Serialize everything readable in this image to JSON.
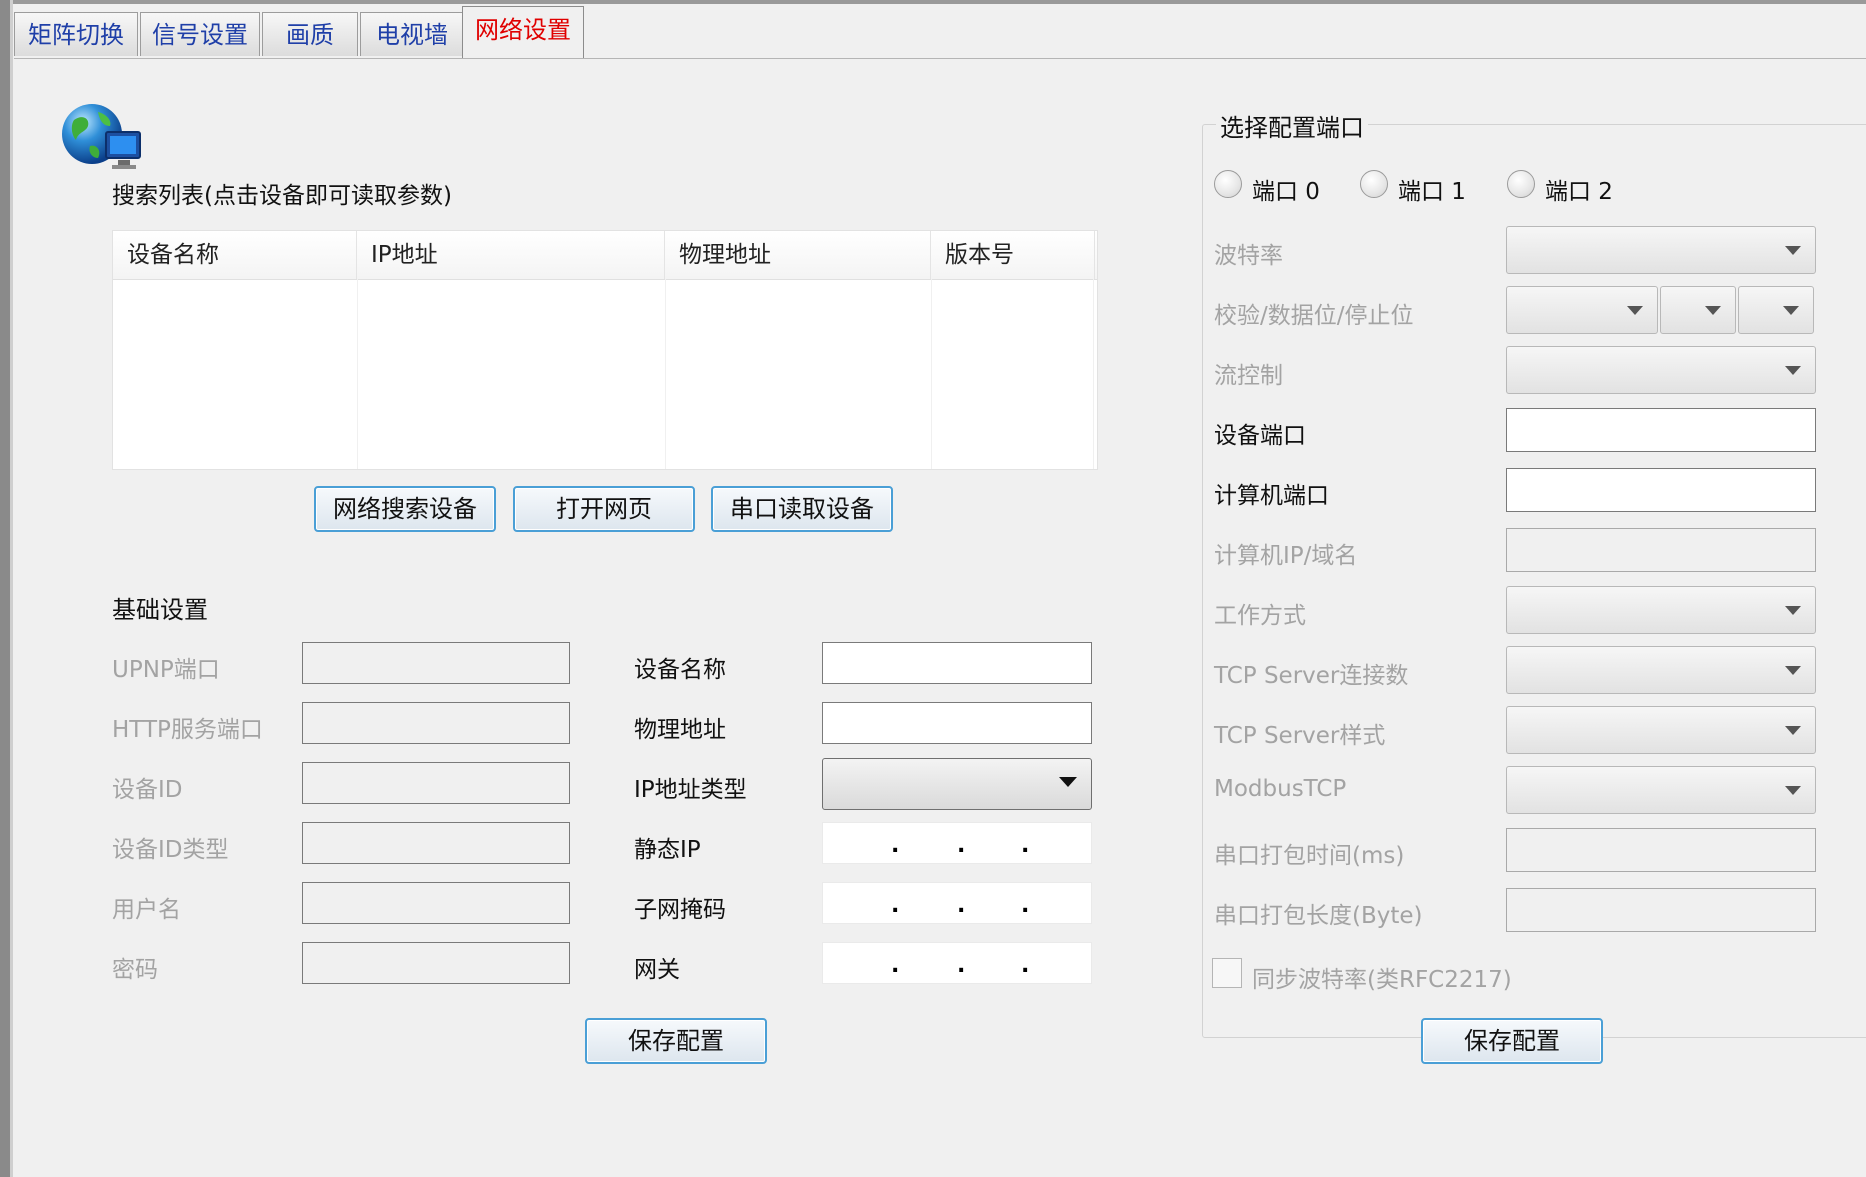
{
  "tabs": [
    {
      "label": "矩阵切换"
    },
    {
      "label": "信号设置"
    },
    {
      "label": "画质"
    },
    {
      "label": "电视墙"
    },
    {
      "label": "网络设置"
    }
  ],
  "search": {
    "caption": "搜索列表(点击设备即可读取参数)",
    "columns": [
      "设备名称",
      "IP地址",
      "物理地址",
      "版本号"
    ],
    "rows": []
  },
  "actions": {
    "net_search": "网络搜索设备",
    "open_web": "打开网页",
    "serial_read": "串口读取设备"
  },
  "basic": {
    "title": "基础设置",
    "upnp_port": "UPNP端口",
    "http_port": "HTTP服务端口",
    "device_id": "设备ID",
    "device_id_type": "设备ID类型",
    "username": "用户名",
    "password": "密码",
    "device_name": "设备名称",
    "mac": "物理地址",
    "ip_type": "IP地址类型",
    "static_ip": "静态IP",
    "subnet": "子网掩码",
    "gateway": "网关",
    "ip_sep": ".",
    "save": "保存配置"
  },
  "port": {
    "title": "选择配置端口",
    "radios": [
      "端口 0",
      "端口 1",
      "端口 2"
    ],
    "baud": "波特率",
    "parity": "校验/数据位/停止位",
    "flow": "流控制",
    "device_port": "设备端口",
    "pc_port": "计算机端口",
    "pc_ip": "计算机IP/域名",
    "work_mode": "工作方式",
    "tcp_conn": "TCP Server连接数",
    "tcp_style": "TCP Server样式",
    "modbus": "ModbusTCP",
    "pack_time": "串口打包时间(ms)",
    "pack_len": "串口打包长度(Byte)",
    "sync_baud": "同步波特率(类RFC2217)",
    "save": "保存配置"
  },
  "colors": {
    "active_tab": "#e00000",
    "tab_text": "#1f3fa8",
    "button_border": "#4a9fd6",
    "disabled_text": "#a3a3a3"
  }
}
